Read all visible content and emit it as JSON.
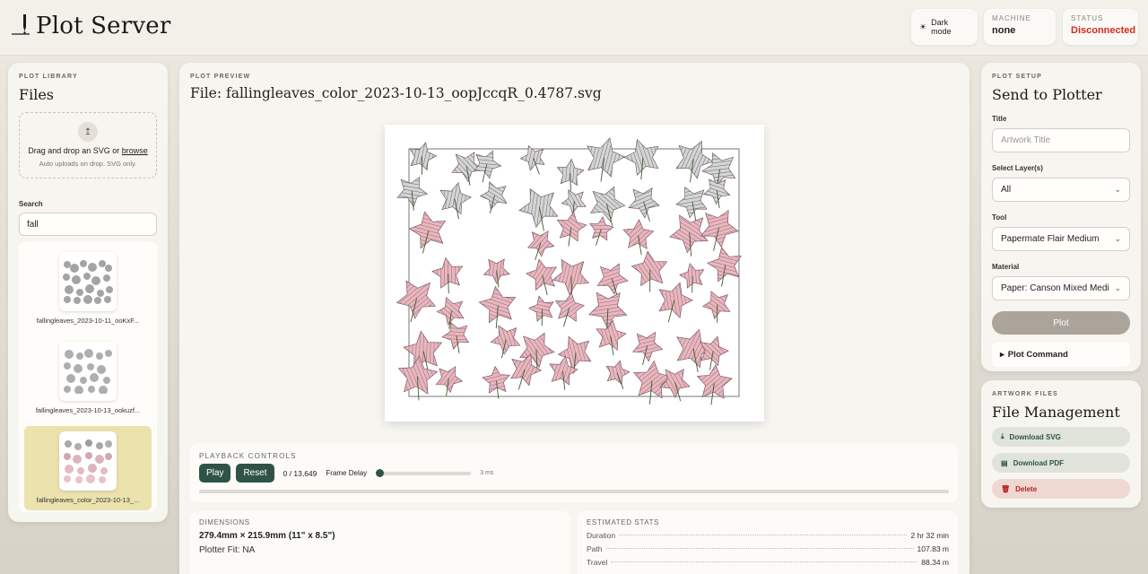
{
  "header": {
    "title": "Plot Server",
    "dark_mode_label": "Dark mode",
    "machine_label": "MACHINE",
    "machine_value": "none",
    "status_label": "STATUS",
    "status_value": "Disconnected",
    "status_color": "#d42b1e"
  },
  "library": {
    "eyebrow": "PLOT LIBRARY",
    "title": "Files",
    "drop_text": "Drag and drop an SVG or",
    "browse_link": "browse",
    "drop_sub": "Auto uploads on drop. SVG only.",
    "search_label": "Search",
    "search_value": "fall",
    "files": [
      {
        "name": "fallingleaves_2023-10-11_ooKxF..."
      },
      {
        "name": "fallingleaves_2023-10-13_ookuzf..."
      },
      {
        "name": "fallingleaves_color_2023-10-13_...",
        "selected": true
      }
    ]
  },
  "preview": {
    "eyebrow": "PLOT PREVIEW",
    "title": "File: fallingleaves_color_2023-10-13_oopJccqR_0.4787.svg",
    "playback": {
      "label": "PLAYBACK CONTROLS",
      "play": "Play",
      "reset": "Reset",
      "count": "0 / 13,649",
      "frame_delay_label": "Frame Delay",
      "frame_delay_value": "3 ms",
      "progress": 0
    },
    "dimensions": {
      "label": "DIMENSIONS",
      "value": "279.4mm × 215.9mm (11\" x 8.5\")",
      "fit": "Plotter Fit: NA"
    },
    "stats": {
      "label": "ESTIMATED STATS",
      "rows": [
        {
          "k": "Duration",
          "v": "2 hr 32 min"
        },
        {
          "k": "Path",
          "v": "107.83 m"
        },
        {
          "k": "Travel",
          "v": "88.34 m"
        }
      ]
    }
  },
  "setup": {
    "eyebrow": "PLOT SETUP",
    "title": "Send to Plotter",
    "title_label": "Title",
    "title_placeholder": "Artwork Title",
    "layer_label": "Select Layer(s)",
    "layer_value": "All",
    "tool_label": "Tool",
    "tool_value": "Papermate Flair Medium",
    "material_label": "Material",
    "material_value": "Paper: Canson Mixed Medi",
    "plot_button": "Plot",
    "plot_command": "Plot Command"
  },
  "files_mgmt": {
    "eyebrow": "ARTWORK FILES",
    "title": "File Management",
    "download_svg": "Download SVG",
    "download_pdf": "Download PDF",
    "delete": "Delete"
  },
  "colors": {
    "accent": "#2f5447",
    "selected_item": "#ece2ad",
    "leaf_fill": "#e8b8c0"
  }
}
